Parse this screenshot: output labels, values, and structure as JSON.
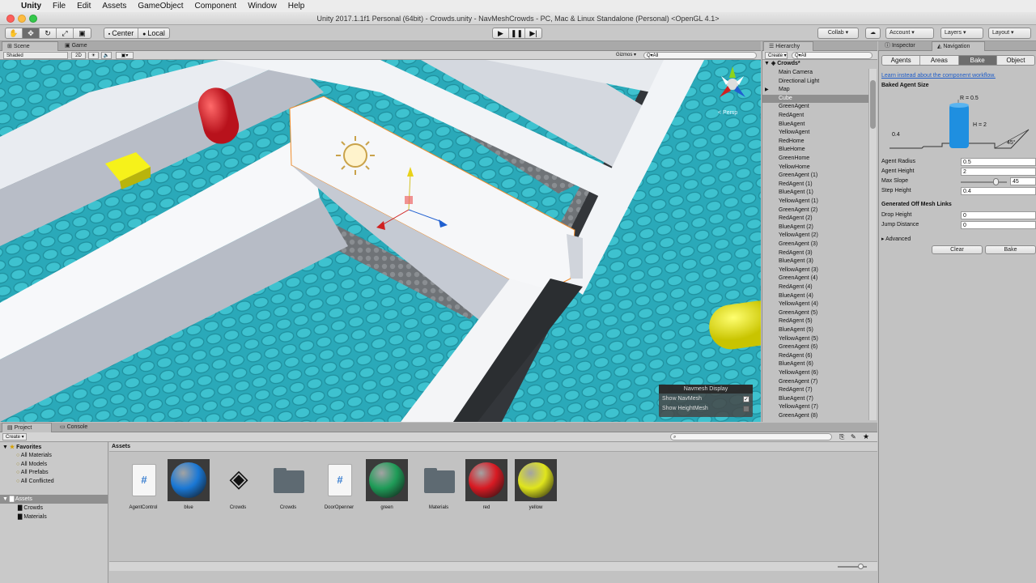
{
  "menubar": {
    "apple": "",
    "app": "Unity",
    "items": [
      "File",
      "Edit",
      "Assets",
      "GameObject",
      "Component",
      "Window",
      "Help"
    ]
  },
  "window": {
    "title": "Unity 2017.1.1f1 Personal (64bit) - Crowds.unity - NavMeshCrowds - PC, Mac & Linux Standalone (Personal) <OpenGL 4.1>"
  },
  "toolbar": {
    "center": "Center",
    "local": "Local",
    "collab": "Collab ▾",
    "account": "Account",
    "layers": "Layers",
    "layout": "Layout"
  },
  "tabs": {
    "scene": "Scene",
    "game": "Game",
    "hierarchy": "Hierarchy",
    "inspector": "Inspector",
    "navigation": "Navigation",
    "project": "Project",
    "console": "Console"
  },
  "scenebar": {
    "shading": "Shaded",
    "mode2d": "2D",
    "gizmos": "Gizmos ▾",
    "search": "Q▾All",
    "persp": "< Persp"
  },
  "navmesh_display": {
    "title": "Navmesh Display",
    "show_navmesh": "Show NavMesh",
    "show_heightmesh": "Show HeightMesh"
  },
  "hierarchy": {
    "create": "Create ▾",
    "search": "Q▾All",
    "scene": "Crowds*",
    "selected": "Cube",
    "items": [
      "Main Camera",
      "Directional Light",
      "Map",
      "Cube",
      "GreenAgent",
      "RedAgent",
      "BlueAgent",
      "YellowAgent",
      "RedHome",
      "BlueHome",
      "GreenHome",
      "YellowHome",
      "GreenAgent (1)",
      "RedAgent (1)",
      "BlueAgent (1)",
      "YellowAgent (1)",
      "GreenAgent (2)",
      "RedAgent (2)",
      "BlueAgent (2)",
      "YellowAgent (2)",
      "GreenAgent (3)",
      "RedAgent (3)",
      "BlueAgent (3)",
      "YellowAgent (3)",
      "GreenAgent (4)",
      "RedAgent (4)",
      "BlueAgent (4)",
      "YellowAgent (4)",
      "GreenAgent (5)",
      "RedAgent (5)",
      "BlueAgent (5)",
      "YellowAgent (5)",
      "GreenAgent (6)",
      "RedAgent (6)",
      "BlueAgent (6)",
      "YellowAgent (6)",
      "GreenAgent (7)",
      "RedAgent (7)",
      "BlueAgent (7)",
      "YellowAgent (7)",
      "GreenAgent (8)"
    ]
  },
  "navigation": {
    "tabs": [
      "Agents",
      "Areas",
      "Bake",
      "Object"
    ],
    "active_tab": "Bake",
    "link": "Learn instead about the component workflow.",
    "baked_title": "Baked Agent Size",
    "diagram": {
      "radius": "R = 0.5",
      "height": "H = 2",
      "step": "0.4",
      "slope": "45°"
    },
    "fields": [
      {
        "label": "Agent Radius",
        "value": "0.5"
      },
      {
        "label": "Agent Height",
        "value": "2"
      },
      {
        "label": "Max Slope",
        "value": "45"
      },
      {
        "label": "Step Height",
        "value": "0.4"
      }
    ],
    "max_slope_fraction": 0.75,
    "offmesh_title": "Generated Off Mesh Links",
    "offmesh_fields": [
      {
        "label": "Drop Height",
        "value": "0"
      },
      {
        "label": "Jump Distance",
        "value": "0"
      }
    ],
    "advanced": "Advanced",
    "clear": "Clear",
    "bake": "Bake"
  },
  "project": {
    "create": "Create ▾",
    "favorites": {
      "title": "Favorites",
      "items": [
        "All Materials",
        "All Models",
        "All Prefabs",
        "All Conflicted"
      ]
    },
    "assets_tree": {
      "title": "Assets",
      "items": [
        "Crowds",
        "Materials"
      ]
    },
    "breadcrumb": "Assets",
    "assets": [
      {
        "name": "AgentControl",
        "kind": "script"
      },
      {
        "name": "blue",
        "kind": "material",
        "color": "#1a78d6"
      },
      {
        "name": "Crowds",
        "kind": "unity"
      },
      {
        "name": "Crowds",
        "kind": "folder"
      },
      {
        "name": "DoorOpenner",
        "kind": "script"
      },
      {
        "name": "green",
        "kind": "material",
        "color": "#1f9c58"
      },
      {
        "name": "Materials",
        "kind": "folder"
      },
      {
        "name": "red",
        "kind": "material",
        "color": "#d81a23"
      },
      {
        "name": "yellow",
        "kind": "material",
        "color": "#e0e51c"
      }
    ]
  }
}
